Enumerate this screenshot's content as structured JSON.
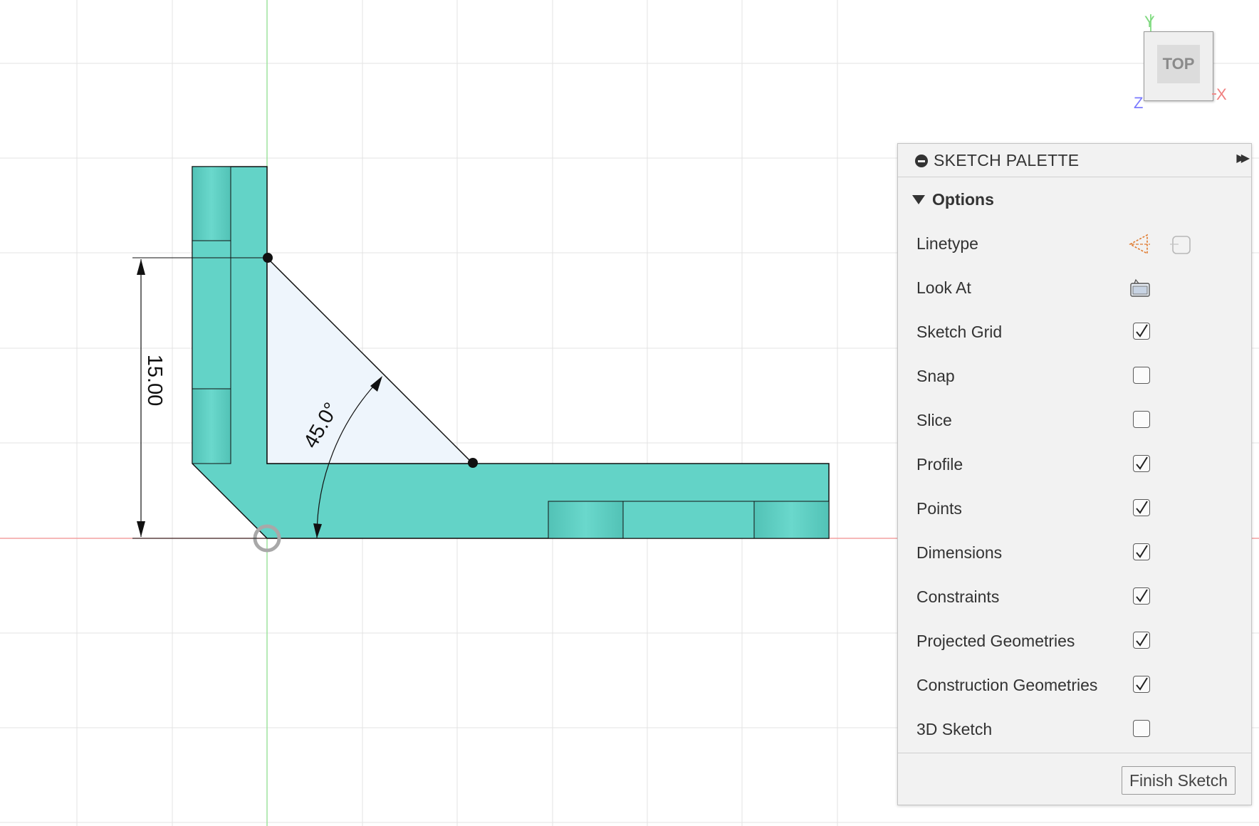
{
  "viewcube": {
    "face_label": "TOP",
    "axis_x": "X",
    "axis_y": "Y",
    "axis_z": "Z"
  },
  "sketch": {
    "dimension_linear": "15.00",
    "dimension_angle": "45.0°"
  },
  "palette": {
    "title": "SKETCH PALETTE",
    "section": "Options",
    "tool_rows": [
      {
        "label": "Linetype",
        "icons": [
          "construction-linetype-icon",
          "centerline-linetype-icon"
        ]
      },
      {
        "label": "Look At",
        "icons": [
          "look-at-icon"
        ]
      }
    ],
    "options": [
      {
        "label": "Sketch Grid",
        "checked": true
      },
      {
        "label": "Snap",
        "checked": false
      },
      {
        "label": "Slice",
        "checked": false
      },
      {
        "label": "Profile",
        "checked": true
      },
      {
        "label": "Points",
        "checked": true
      },
      {
        "label": "Dimensions",
        "checked": true
      },
      {
        "label": "Constraints",
        "checked": true
      },
      {
        "label": "Projected Geometries",
        "checked": true
      },
      {
        "label": "Construction Geometries",
        "checked": true
      },
      {
        "label": "3D Sketch",
        "checked": false
      }
    ],
    "finish_label": "Finish Sketch"
  },
  "colors": {
    "profile_fill": "#63d3c7",
    "triangle_fill": "#eef5fc",
    "x_axis": "#f08a8a",
    "y_axis": "#8ee08e",
    "z_axis": "#7a7aff",
    "grid": "#e3e3e3"
  }
}
